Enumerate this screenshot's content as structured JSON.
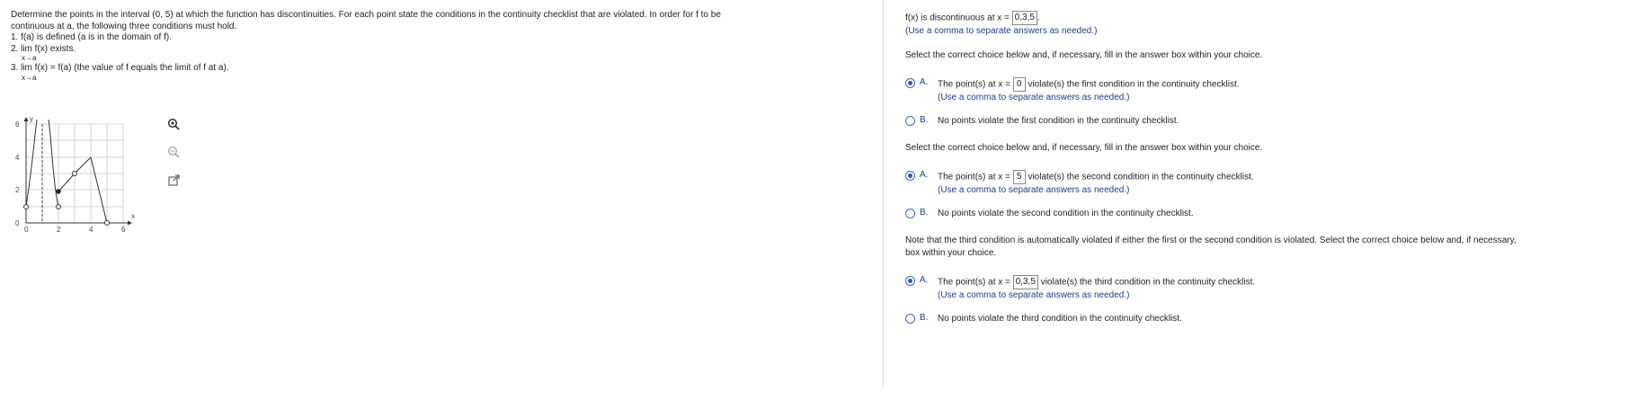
{
  "question": {
    "intro_line1": "Determine the points in the interval (0, 5) at which the function has discontinuities. For each point state the conditions in the continuity checklist that are violated. In order for f to be",
    "intro_line2": "continuous at a, the following three conditions must hold.",
    "cond1": "1. f(a) is defined (a is in the domain of f).",
    "cond2": "2. lim  f(x) exists.",
    "cond2_sub": "x→a",
    "cond3": "3. lim  f(x) = f(a) (the value of f equals the limit of f at a).",
    "cond3_sub": "x→a"
  },
  "graph": {
    "y_axis_label": "y",
    "x_axis_label": "x",
    "x_ticks": [
      "0",
      "2",
      "4",
      "6"
    ],
    "y_ticks": [
      "0",
      "2",
      "4",
      "6"
    ],
    "x_range": [
      0,
      6
    ],
    "y_range": [
      0,
      6
    ],
    "closed_points": [
      [
        2,
        1.9
      ]
    ],
    "open_points": [
      [
        0,
        1
      ],
      [
        2,
        1
      ],
      [
        3,
        3
      ],
      [
        5,
        0
      ]
    ]
  },
  "tools": [
    {
      "icon": "zoom-in-icon"
    },
    {
      "icon": "zoom-out-icon"
    },
    {
      "icon": "external-link-icon"
    }
  ],
  "answer": {
    "disc_prefix": "f(x) is discontinuous at x =",
    "disc_value": "0,3,5",
    "disc_suffix": ".",
    "comma_note": "(Use a comma to separate answers as needed.)",
    "select_prompt": "Select the correct choice below and, if necessary, fill in the answer box within your choice.",
    "q1": {
      "a_letter": "A.",
      "a_prefix": "The point(s) at x =",
      "a_value": "0",
      "a_suffix": "violate(s) the first condition in the continuity checklist.",
      "a_note": "(Use a comma to separate answers as needed.)",
      "b_letter": "B.",
      "b_text": "No points violate the first condition in the continuity checklist."
    },
    "q2": {
      "a_letter": "A.",
      "a_prefix": "The point(s) at x =",
      "a_value": "5",
      "a_suffix": "violate(s) the second condition in the continuity checklist.",
      "a_note": "(Use a comma to separate answers as needed.)",
      "b_letter": "B.",
      "b_text": "No points violate the second condition in the continuity checklist."
    },
    "third_note_line1": "Note that the third condition is automatically violated if either the first or the second condition is violated. Select the correct choice below and, if necessary,",
    "third_note_line2": "box within your choice.",
    "q3": {
      "a_letter": "A.",
      "a_prefix": "The point(s) at x =",
      "a_value": "0,3,5",
      "a_suffix": "violate(s) the third condition in the continuity checklist.",
      "a_note": "(Use a comma to separate answers as needed.)",
      "b_letter": "B.",
      "b_text": "No points violate the third condition in the continuity checklist."
    }
  },
  "colors": {
    "accent_blue": "#1c3d8c",
    "radio_blue": "#2c5ab8"
  }
}
